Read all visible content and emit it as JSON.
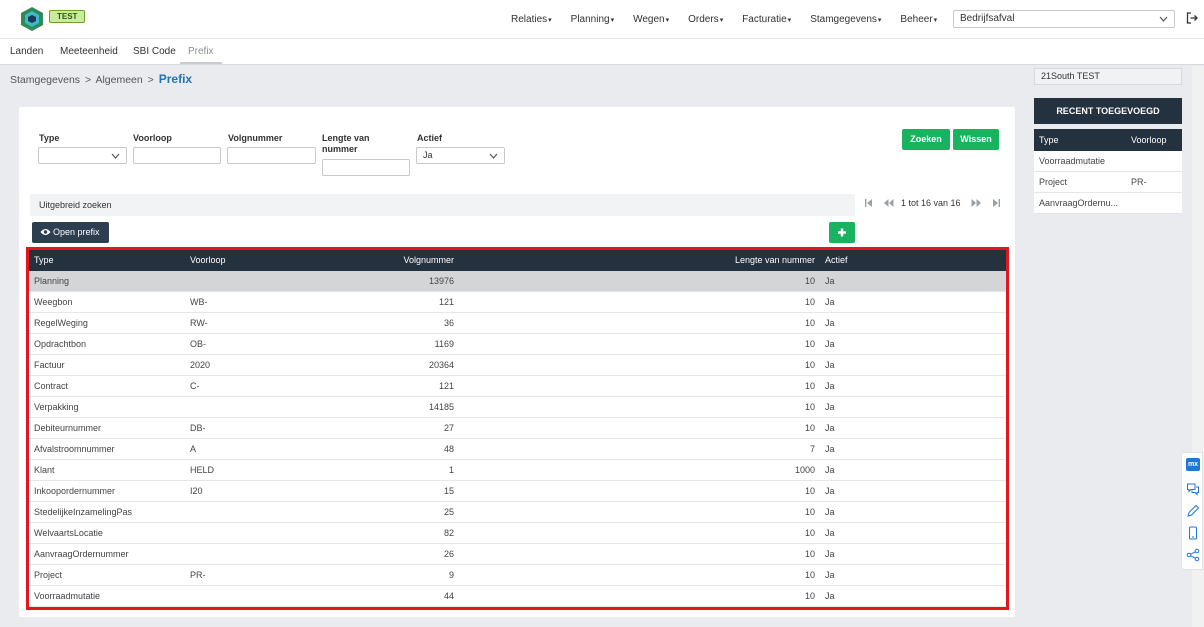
{
  "app": {
    "env_badge": "TEST",
    "menu": [
      "Relaties",
      "Planning",
      "Wegen",
      "Orders",
      "Facturatie",
      "Stamgegevens",
      "Beheer"
    ],
    "company_select": "Bedrijfsafval"
  },
  "tabs": [
    "Landen",
    "Meeteenheid",
    "SBI Code",
    "Prefix"
  ],
  "active_tab": "Prefix",
  "breadcrumb": {
    "part1": "Stamgegevens",
    "part2": "Algemeen",
    "current": "Prefix",
    "separator": ">"
  },
  "search": {
    "type_label": "Type",
    "type_value": "",
    "voorloop_label": "Voorloop",
    "voorloop_value": "",
    "volgnummer_label": "Volgnummer",
    "volgnummer_value": "",
    "lengte_label_1": "Lengte van",
    "lengte_label_2": "nummer",
    "lengte_value": "",
    "actief_label": "Actief",
    "actief_value": "Ja",
    "search_button": "Zoeken",
    "clear_button": "Wissen"
  },
  "advanced_search": "Uitgebreid zoeken",
  "pager": {
    "text": "1 tot 16 van 16"
  },
  "open_button": "Open prefix",
  "table": {
    "headers": {
      "type": "Type",
      "voorloop": "Voorloop",
      "volgnummer": "Volgnummer",
      "lengte": "Lengte van nummer",
      "actief": "Actief"
    },
    "rows": [
      {
        "type": "Planning",
        "voorloop": "",
        "volgnummer": "13976",
        "lengte": "10",
        "actief": "Ja"
      },
      {
        "type": "Weegbon",
        "voorloop": "WB-",
        "volgnummer": "121",
        "lengte": "10",
        "actief": "Ja"
      },
      {
        "type": "RegelWeging",
        "voorloop": "RW-",
        "volgnummer": "36",
        "lengte": "10",
        "actief": "Ja"
      },
      {
        "type": "Opdrachtbon",
        "voorloop": "OB-",
        "volgnummer": "1169",
        "lengte": "10",
        "actief": "Ja"
      },
      {
        "type": "Factuur",
        "voorloop": "2020",
        "volgnummer": "20364",
        "lengte": "10",
        "actief": "Ja"
      },
      {
        "type": "Contract",
        "voorloop": "C-",
        "volgnummer": "121",
        "lengte": "10",
        "actief": "Ja"
      },
      {
        "type": "Verpakking",
        "voorloop": "",
        "volgnummer": "14185",
        "lengte": "10",
        "actief": "Ja"
      },
      {
        "type": "Debiteurnummer",
        "voorloop": "DB-",
        "volgnummer": "27",
        "lengte": "10",
        "actief": "Ja"
      },
      {
        "type": "Afvalstroomnummer",
        "voorloop": "A",
        "volgnummer": "48",
        "lengte": "7",
        "actief": "Ja"
      },
      {
        "type": "Klant",
        "voorloop": "HELD",
        "volgnummer": "1",
        "lengte": "1000",
        "actief": "Ja"
      },
      {
        "type": "Inkoopordernummer",
        "voorloop": "I20",
        "volgnummer": "15",
        "lengte": "10",
        "actief": "Ja"
      },
      {
        "type": "StedelijkeInzamelingPas",
        "voorloop": "",
        "volgnummer": "25",
        "lengte": "10",
        "actief": "Ja"
      },
      {
        "type": "WelvaartsLocatie",
        "voorloop": "",
        "volgnummer": "82",
        "lengte": "10",
        "actief": "Ja"
      },
      {
        "type": "AanvraagOrdernummer",
        "voorloop": "",
        "volgnummer": "26",
        "lengte": "10",
        "actief": "Ja"
      },
      {
        "type": "Project",
        "voorloop": "PR-",
        "volgnummer": "9",
        "lengte": "10",
        "actief": "Ja"
      },
      {
        "type": "Voorraadmutatie",
        "voorloop": "",
        "volgnummer": "44",
        "lengte": "10",
        "actief": "Ja"
      }
    ]
  },
  "right_panel": {
    "tenant": "21South TEST",
    "recent_title": "RECENT TOEGEVOEGD",
    "headers": {
      "type": "Type",
      "voorloop": "Voorloop"
    },
    "rows": [
      {
        "type": "Voorraadmutatie",
        "voorloop": ""
      },
      {
        "type": "Project",
        "voorloop": "PR-"
      },
      {
        "type": "AanvraagOrdernu...",
        "voorloop": ""
      }
    ]
  },
  "side_tools": {
    "badge": "mx"
  },
  "colors": {
    "header_dark": "#24313e",
    "green": "#19b35f",
    "highlight_red": "#e4151c",
    "link_blue": "#1f74b6"
  }
}
